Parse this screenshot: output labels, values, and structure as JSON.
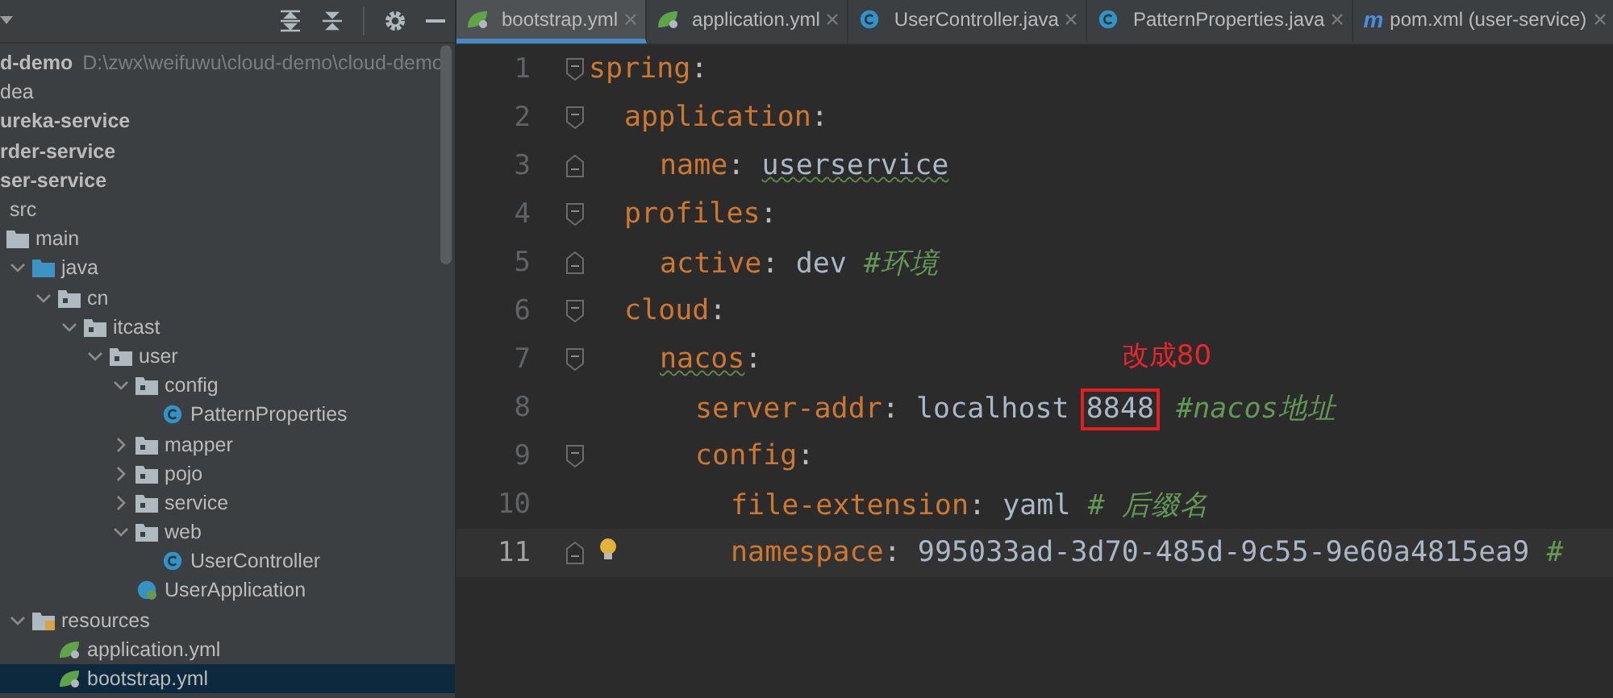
{
  "sidebar": {
    "tree": [
      {
        "name": "d-demo",
        "path": "D:\\zwx\\weifuwu\\cloud-demo\\cloud-demo",
        "kind": "project",
        "selected": false,
        "children": [
          {
            "name": "dea",
            "selected": false
          },
          {
            "name": "ureka-service",
            "kind": "module",
            "selected": false
          },
          {
            "name": "rder-service",
            "kind": "module",
            "selected": false
          },
          {
            "name": "ser-service",
            "kind": "module",
            "selected": false,
            "children": [
              {
                "name": "src",
                "selected": false,
                "children": [
                  {
                    "name": "main",
                    "kind": "folder",
                    "selected": false,
                    "children": [
                      {
                        "name": "java",
                        "kind": "source-root",
                        "expanded": true,
                        "selected": false,
                        "children": [
                          {
                            "name": "cn",
                            "kind": "package",
                            "expanded": true,
                            "selected": false,
                            "children": [
                              {
                                "name": "itcast",
                                "kind": "package",
                                "expanded": true,
                                "selected": false,
                                "children": [
                                  {
                                    "name": "user",
                                    "kind": "package",
                                    "expanded": true,
                                    "selected": false,
                                    "children": [
                                      {
                                        "name": "config",
                                        "kind": "package",
                                        "expanded": true,
                                        "selected": false,
                                        "children": [
                                          {
                                            "name": "PatternProperties",
                                            "kind": "class",
                                            "selected": false
                                          }
                                        ]
                                      },
                                      {
                                        "name": "mapper",
                                        "kind": "package",
                                        "expanded": false,
                                        "selected": false
                                      },
                                      {
                                        "name": "pojo",
                                        "kind": "package",
                                        "expanded": false,
                                        "selected": false
                                      },
                                      {
                                        "name": "service",
                                        "kind": "package",
                                        "expanded": false,
                                        "selected": false
                                      },
                                      {
                                        "name": "web",
                                        "kind": "package",
                                        "expanded": true,
                                        "selected": false,
                                        "children": [
                                          {
                                            "name": "UserController",
                                            "kind": "class",
                                            "selected": false
                                          }
                                        ]
                                      },
                                      {
                                        "name": "UserApplication",
                                        "kind": "spring-class",
                                        "selected": false
                                      }
                                    ]
                                  }
                                ]
                              }
                            ]
                          }
                        ]
                      },
                      {
                        "name": "resources",
                        "kind": "resource-root",
                        "expanded": true,
                        "selected": false,
                        "children": [
                          {
                            "name": "application.yml",
                            "kind": "spring-yml",
                            "selected": false
                          },
                          {
                            "name": "bootstrap.yml",
                            "kind": "spring-yml",
                            "selected": true
                          }
                        ]
                      }
                    ]
                  }
                ]
              }
            ]
          }
        ]
      }
    ]
  },
  "tabs": [
    {
      "label": "bootstrap.yml",
      "kind": "spring-yml",
      "selected": true
    },
    {
      "label": "application.yml",
      "kind": "spring-yml",
      "selected": false
    },
    {
      "label": "UserController.java",
      "kind": "class",
      "selected": false
    },
    {
      "label": "PatternProperties.java",
      "kind": "class",
      "selected": false
    },
    {
      "label": "pom.xml (user-service)",
      "kind": "maven",
      "glyph": "m",
      "selected": false
    }
  ],
  "editor": {
    "lines": [
      {
        "number": "1",
        "kind": "fold-start",
        "current": false,
        "tokens": [
          {
            "kind": "key",
            "text": "spring"
          },
          {
            "kind": "punct",
            "text": ":"
          }
        ],
        "children": [
          {
            "number": "2",
            "kind": "fold-start",
            "current": false,
            "tokens": [
              {
                "kind": "key",
                "text": "application"
              },
              {
                "kind": "punct",
                "text": ":"
              }
            ],
            "children": [
              {
                "number": "3",
                "kind": "fold-end",
                "current": false,
                "tokens": [
                  {
                    "kind": "key",
                    "text": "name"
                  },
                  {
                    "kind": "punct",
                    "text": ":"
                  },
                  {
                    "kind": "value",
                    "text": "userservice",
                    "squiggle": true
                  }
                ]
              }
            ]
          },
          {
            "number": "4",
            "kind": "fold-start",
            "current": false,
            "tokens": [
              {
                "kind": "key",
                "text": "profiles"
              },
              {
                "kind": "punct",
                "text": ":"
              }
            ],
            "children": [
              {
                "number": "5",
                "kind": "fold-end",
                "current": false,
                "tokens": [
                  {
                    "kind": "key",
                    "text": "active"
                  },
                  {
                    "kind": "punct",
                    "text": ":"
                  },
                  {
                    "kind": "value",
                    "text": "dev"
                  },
                  {
                    "kind": "comment",
                    "text": "#环境"
                  }
                ]
              }
            ]
          },
          {
            "number": "6",
            "kind": "fold-start",
            "current": false,
            "tokens": [
              {
                "kind": "key",
                "text": "cloud"
              },
              {
                "kind": "punct",
                "text": ":"
              }
            ],
            "children": [
              {
                "number": "7",
                "kind": "fold-start",
                "current": false,
                "tokens": [
                  {
                    "kind": "key",
                    "text": "nacos",
                    "squiggle": true
                  },
                  {
                    "kind": "punct",
                    "text": ":"
                  }
                ],
                "children": [
                  {
                    "number": "8",
                    "kind": "plain",
                    "current": false,
                    "tokens": [
                      {
                        "kind": "key",
                        "text": "server-addr"
                      },
                      {
                        "kind": "punct",
                        "text": ":"
                      },
                      {
                        "kind": "value",
                        "text": "localhost"
                      },
                      {
                        "kind": "value",
                        "text": "8848",
                        "boxed": true,
                        "annotation": "改成80"
                      },
                      {
                        "kind": "comment",
                        "text": "#nacos地址"
                      }
                    ]
                  },
                  {
                    "number": "9",
                    "kind": "fold-start",
                    "current": false,
                    "tokens": [
                      {
                        "kind": "key",
                        "text": "config"
                      },
                      {
                        "kind": "punct",
                        "text": ":"
                      }
                    ],
                    "children": [
                      {
                        "number": "10",
                        "kind": "plain",
                        "current": false,
                        "tokens": [
                          {
                            "kind": "key",
                            "text": "file-extension"
                          },
                          {
                            "kind": "punct",
                            "text": ":"
                          },
                          {
                            "kind": "value",
                            "text": "yaml"
                          },
                          {
                            "kind": "comment",
                            "text": "# 后缀名"
                          }
                        ]
                      },
                      {
                        "number": "11",
                        "kind": "fold-end",
                        "current": true,
                        "bulb": true,
                        "tokens": [
                          {
                            "kind": "key",
                            "text": "namespace"
                          },
                          {
                            "kind": "punct",
                            "text": ":"
                          },
                          {
                            "kind": "value",
                            "text": "995033ad-3d70-485d-9c55-9e60a4815ea9"
                          },
                          {
                            "kind": "comment",
                            "text": "#"
                          }
                        ]
                      }
                    ]
                  }
                ]
              }
            ]
          }
        ]
      }
    ]
  }
}
